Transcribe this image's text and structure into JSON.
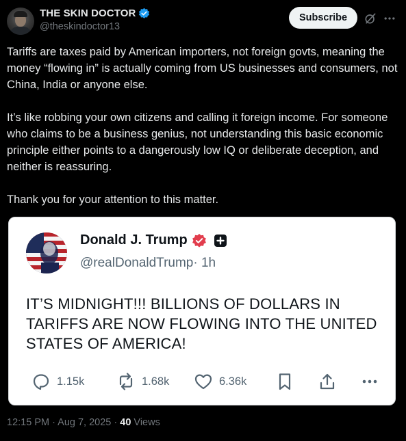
{
  "post": {
    "author": {
      "display_name": "THE SKIN DOCTOR",
      "handle": "@theskindoctor13",
      "verified_color": "#1d9bf0"
    },
    "subscribe_label": "Subscribe",
    "paragraphs": [
      "Tariffs are taxes paid by American importers, not foreign govts, meaning the money “flowing in” is actually coming from US businesses and consumers, not China, India or anyone else.",
      "It’s like robbing your own citizens and calling it foreign income. For someone who claims to be a business genius, not understanding this basic economic principle either points to a dangerously low IQ or deliberate deception, and neither is reassuring.",
      "Thank you for your attention to this matter."
    ],
    "timestamp": "12:15 PM · Aug 7, 2025 · ",
    "views_count": "40",
    "views_label": " Views"
  },
  "embedded": {
    "display_name": "Donald J. Trump",
    "handle": "@realDonaldTrump",
    "time": " · 1h",
    "text": "IT’S MIDNIGHT!!! BILLIONS OF DOLLARS IN TARIFFS ARE NOW FLOWING INTO THE UNITED STATES OF AMERICA!",
    "replies": "1.15k",
    "reposts": "1.68k",
    "likes": "6.36k",
    "badge_color": "#e23d4d"
  },
  "icons": [
    "verified-icon",
    "grok-icon",
    "more-icon",
    "reply-icon",
    "repost-icon",
    "like-icon",
    "bookmark-icon",
    "share-icon",
    "plus-icon"
  ]
}
